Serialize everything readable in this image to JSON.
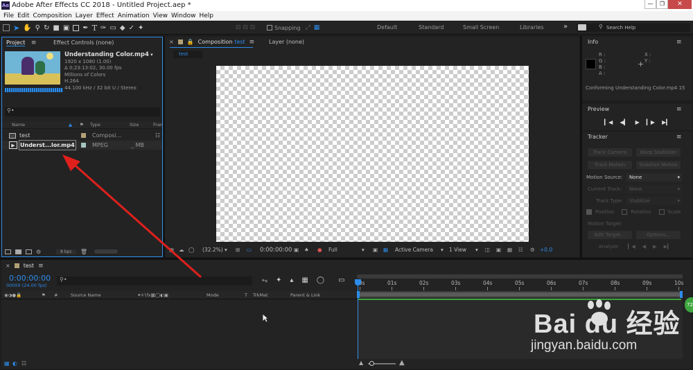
{
  "window": {
    "title": "Adobe After Effects CC 2018 - Untitled Project.aep *",
    "app_icon_text": "Ae"
  },
  "menu": [
    "File",
    "Edit",
    "Composition",
    "Layer",
    "Effect",
    "Animation",
    "View",
    "Window",
    "Help"
  ],
  "toolbar": {
    "snapping_label": "Snapping",
    "workspaces": [
      "Default",
      "Standard",
      "Small Screen",
      "Libraries"
    ],
    "search_placeholder": "Search Help"
  },
  "project_panel": {
    "tab_project": "Project",
    "tab_effect_controls": "Effect Controls (none)",
    "footage": {
      "name": "Understanding Color.mp4",
      "dimensions": "1920 x 1080 (1.00)",
      "duration": "Δ 0;23:13:02, 30.00 fps",
      "colors": "Millions of Colors",
      "codec": "H.264",
      "audio": "44.100 kHz / 32 bit U / Stereo"
    },
    "columns": [
      "Name",
      "Type",
      "Size",
      "Fran"
    ],
    "items": [
      {
        "name": "test",
        "type": "Composi...",
        "size": ""
      },
      {
        "name": "Underst...lor.mp4",
        "type": "MPEG",
        "size": "_ MB"
      }
    ],
    "bpc": "8 bpc"
  },
  "composition_panel": {
    "tab_composition": "Composition",
    "tab_comp_name": "test",
    "tab_layer": "Layer (none)",
    "flow_tab": "test",
    "zoom": "(32.2%)",
    "timecode": "0:00:00:00",
    "resolution": "Full",
    "camera": "Active Camera",
    "views": "1 View",
    "exposure": "+0.0"
  },
  "info_panel": {
    "title": "Info",
    "rgba": [
      "R :",
      "G :",
      "B :",
      "A :"
    ],
    "xy": [
      "X :",
      "Y :"
    ],
    "status": "Conforming Understanding Color.mp4 15"
  },
  "preview_panel": {
    "title": "Preview"
  },
  "tracker_panel": {
    "title": "Tracker",
    "track_camera": "Track Camera",
    "warp_stabilizer": "Warp Stabilizer",
    "track_motion": "Track Motion",
    "stabilize_motion": "Stabilize Motion",
    "motion_source_label": "Motion Source:",
    "motion_source_value": "None",
    "current_track_label": "Current Track:",
    "current_track_value": "None",
    "track_type_label": "Track Type:",
    "track_type_value": "Stabilize",
    "position": "Position",
    "rotation": "Rotation",
    "scale": "Scale",
    "motion_target": "Motion Target:",
    "edit_target": "Edit Target...",
    "options": "Options...",
    "analyze": "Analyze:"
  },
  "timeline": {
    "tab_name": "test",
    "timecode": "0:00:00:00",
    "frames": "00000 (24.00 fps)",
    "layer_columns": [
      "#",
      "Source Name",
      "Mode",
      "T",
      "TrkMat",
      "Parent & Link"
    ],
    "ruler": [
      "00s",
      "01s",
      "02s",
      "03s",
      "04s",
      "05s",
      "06s",
      "07s",
      "08s",
      "09s",
      "10s"
    ],
    "green_badge": "72"
  },
  "watermark": {
    "logo_text": "Bai  du 经验",
    "url": "jingyan.baidu.com"
  },
  "colors": {
    "accent_blue": "#2d8ceb",
    "arrow_red": "#e0201c",
    "work_area_green": "#3ea53e"
  }
}
